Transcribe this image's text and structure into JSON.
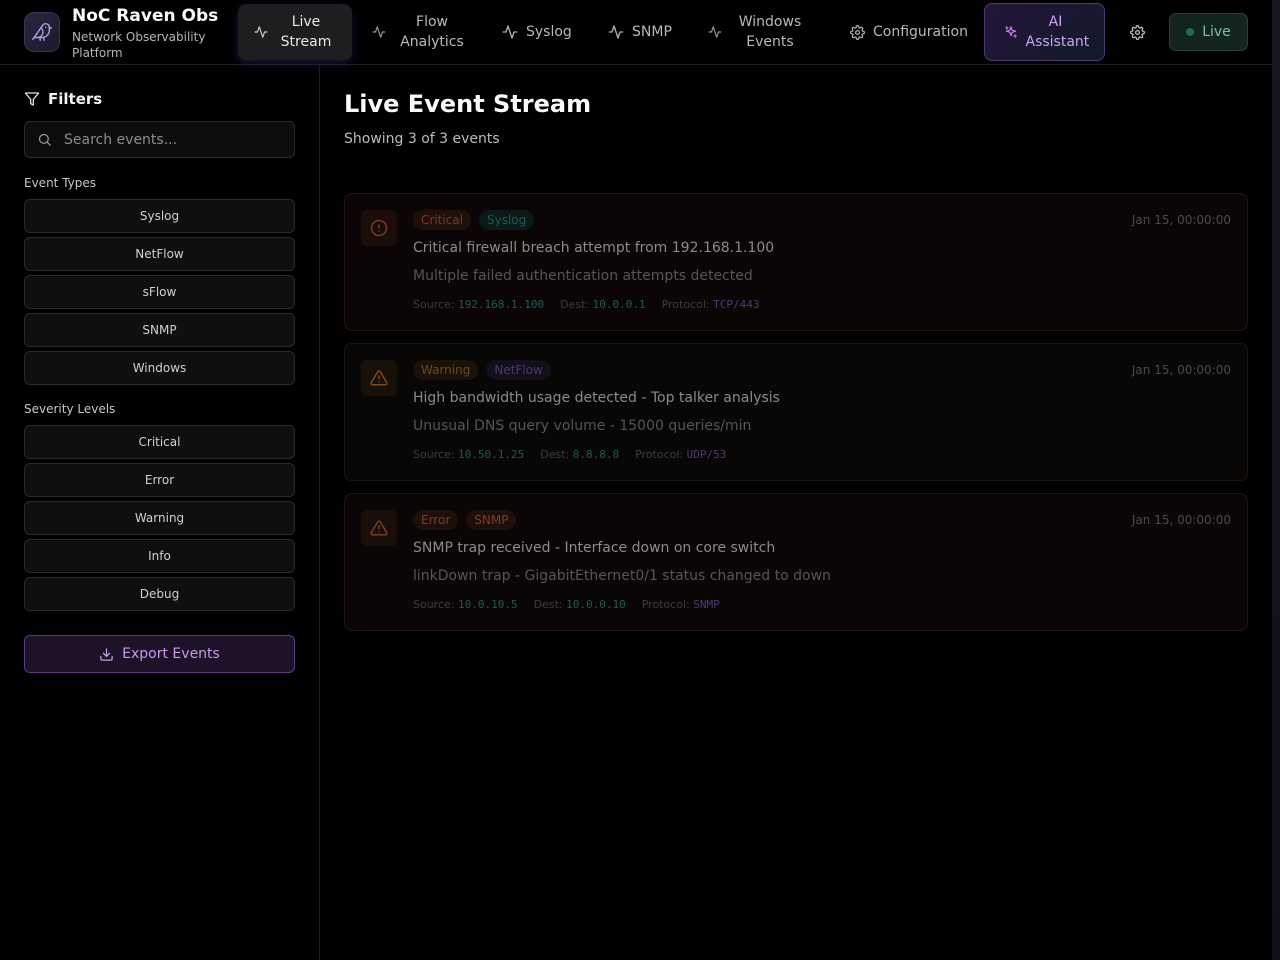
{
  "app": {
    "title": "NoC Raven Obs",
    "subtitle": "Network Observability Platform"
  },
  "nav": {
    "items": [
      {
        "label": "Live Stream",
        "icon": "activity-icon",
        "active": true
      },
      {
        "label": "Flow Analytics",
        "icon": "activity-icon"
      },
      {
        "label": "Syslog",
        "icon": "activity-icon"
      },
      {
        "label": "SNMP",
        "icon": "activity-icon"
      },
      {
        "label": "Windows Events",
        "icon": "activity-icon"
      },
      {
        "label": "Configuration",
        "icon": "gear-icon"
      }
    ],
    "ai_label": "AI Assistant",
    "live_label": "Live"
  },
  "sidebar": {
    "filters_title": "Filters",
    "search_placeholder": "Search events...",
    "event_types_label": "Event Types",
    "event_types": [
      "Syslog",
      "NetFlow",
      "sFlow",
      "SNMP",
      "Windows"
    ],
    "severity_label": "Severity Levels",
    "severities": [
      "Critical",
      "Error",
      "Warning",
      "Info",
      "Debug"
    ],
    "export_label": "Export Events"
  },
  "main": {
    "title": "Live Event Stream",
    "subtitle": "Showing 3 of 3 events",
    "events": [
      {
        "severity": "Critical",
        "type": "Syslog",
        "time": "Jan 15, 00:00:00",
        "title": "Critical firewall breach attempt from 192.168.1.100",
        "message": "Multiple failed authentication attempts detected",
        "source_label": "Source:",
        "source": "192.168.1.100",
        "dest_label": "Dest:",
        "dest": "10.0.0.1",
        "protocol_label": "Protocol:",
        "protocol": "TCP/443"
      },
      {
        "severity": "Warning",
        "type": "NetFlow",
        "time": "Jan 15, 00:00:00",
        "title": "High bandwidth usage detected - Top talker analysis",
        "message": "Unusual DNS query volume - 15000 queries/min",
        "source_label": "Source:",
        "source": "10.50.1.25",
        "dest_label": "Dest:",
        "dest": "8.8.8.8",
        "protocol_label": "Protocol:",
        "protocol": "UDP/53"
      },
      {
        "severity": "Error",
        "type": "SNMP",
        "time": "Jan 15, 00:00:00",
        "title": "SNMP trap received - Interface down on core switch",
        "message": "linkDown trap - GigabitEthernet0/1 status changed to down",
        "source_label": "Source:",
        "source": "10.0.10.5",
        "dest_label": "Dest:",
        "dest": "10.0.0.10",
        "protocol_label": "Protocol:",
        "protocol": "SNMP"
      }
    ]
  },
  "colors": {
    "critical": "#7a3a2a",
    "warning": "#6a4a22",
    "error": "#7a3d25",
    "syslog": "#1f5a55",
    "netflow": "#4a3a78",
    "snmp": "#7a3d25",
    "ip": "#1f5a55",
    "protocol": "#4a3a78",
    "accent": "#c59be8"
  }
}
